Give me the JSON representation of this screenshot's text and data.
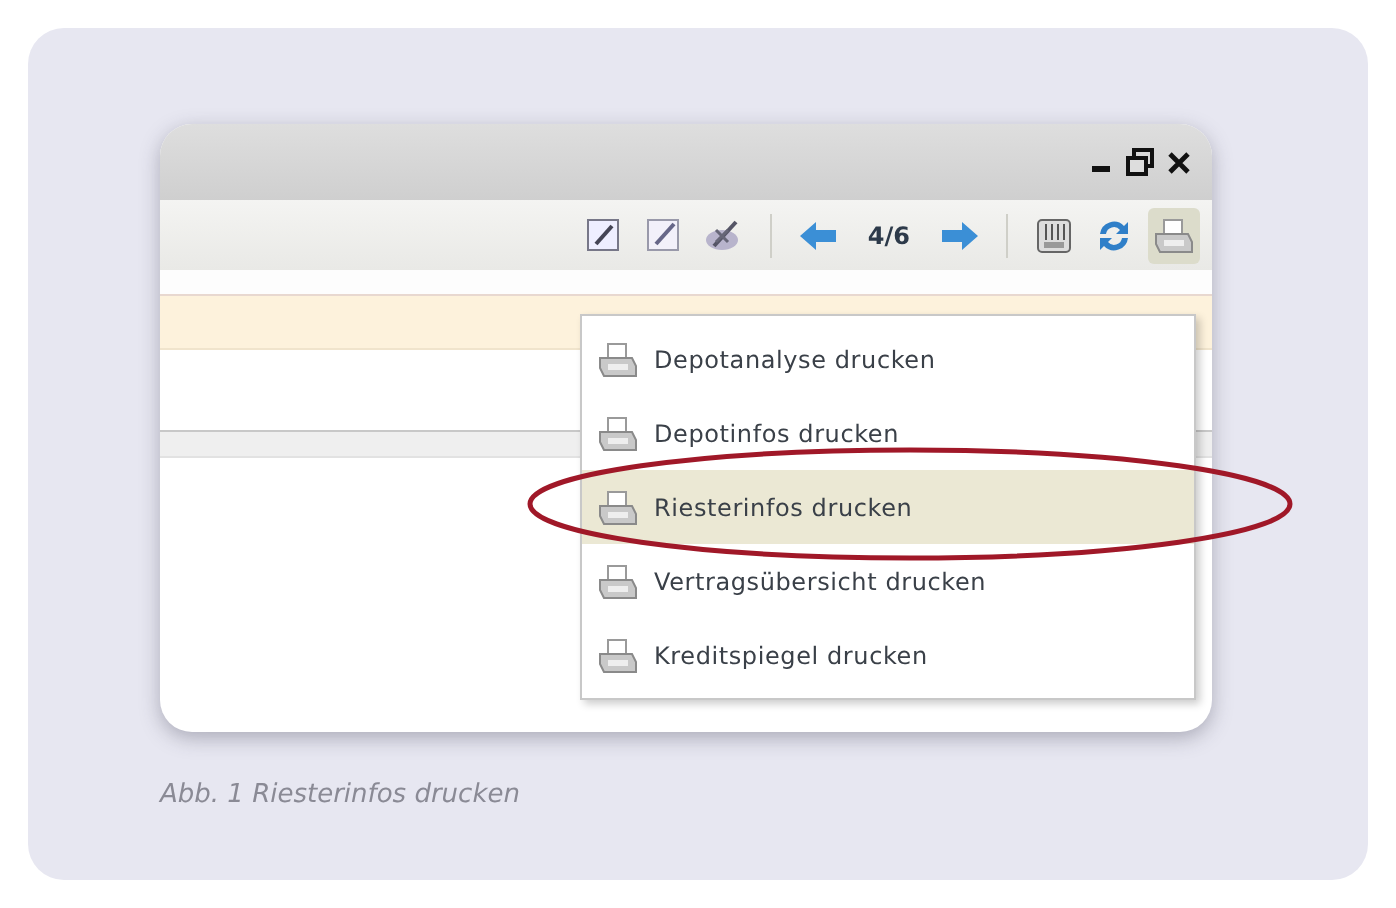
{
  "toolbar": {
    "pager": "4/6",
    "print_pressed": true
  },
  "print_menu": {
    "open": true,
    "items": [
      {
        "label": "Depotanalyse drucken",
        "selected": false
      },
      {
        "label": "Depotinfos drucken",
        "selected": false
      },
      {
        "label": "Riesterinfos drucken",
        "selected": true
      },
      {
        "label": "Vertragsübersicht drucken",
        "selected": false
      },
      {
        "label": "Kreditspiegel drucken",
        "selected": false
      }
    ]
  },
  "caption": "Abb. 1 Riesterinfos drucken"
}
